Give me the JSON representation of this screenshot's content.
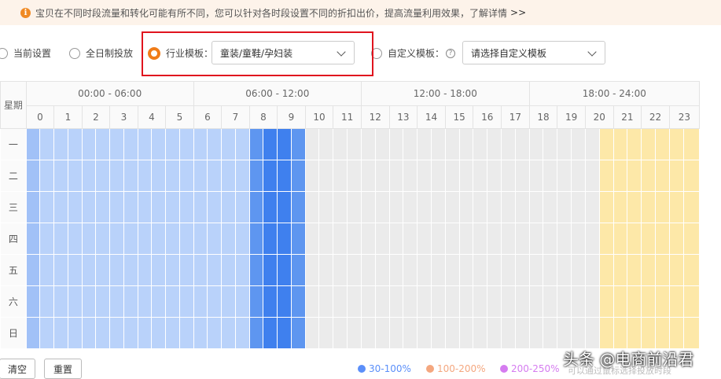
{
  "notice": {
    "icon": "info-icon",
    "text": "宝贝在不同时段流量和转化可能有所不同，您可以针对各时段设置不同的折扣出价，提高流量利用效果，了解详情",
    "more": ">>"
  },
  "options": {
    "current_label": "当前设置",
    "allday_label": "全日制投放",
    "industry_label": "行业模板：",
    "industry_select": "童装/童鞋/孕妇装",
    "custom_label": "自定义模板：",
    "custom_select": "请选择自定义模板",
    "selected": "industry"
  },
  "schedule": {
    "day_header": "星期",
    "ranges": [
      "00:00 - 06:00",
      "06:00 - 12:00",
      "12:00 - 18:00",
      "18:00 - 24:00"
    ],
    "hours": [
      "0",
      "1",
      "2",
      "3",
      "4",
      "5",
      "6",
      "7",
      "8",
      "9",
      "10",
      "11",
      "12",
      "13",
      "14",
      "15",
      "16",
      "17",
      "18",
      "19",
      "20",
      "21",
      "22",
      "23"
    ],
    "days": [
      "一",
      "二",
      "三",
      "四",
      "五",
      "六",
      "日"
    ],
    "palette": {
      "0": "#ebebeb",
      "1": "#b9d2fa",
      "2": "#a1c1f7",
      "3": "#5e96f0",
      "4": "#3f80ee",
      "5": "#2a72ea",
      "6": "#fde8a8"
    },
    "levels": [
      [
        2,
        1,
        1,
        1,
        1,
        1,
        1,
        1,
        1,
        1,
        1,
        1,
        1,
        1,
        1,
        1,
        3,
        4,
        4,
        3,
        0,
        0,
        0,
        0,
        0,
        0,
        0,
        0,
        0,
        0,
        0,
        0,
        0,
        0,
        0,
        0,
        0,
        0,
        0,
        0,
        0,
        6,
        6,
        6,
        6,
        6,
        6,
        6,
        6,
        6,
        6,
        6,
        6,
        6,
        6,
        3,
        3,
        3,
        3,
        3,
        3,
        4,
        4,
        4,
        4,
        5,
        5,
        5,
        5,
        5,
        5,
        4,
        4,
        3,
        3
      ],
      [
        2,
        1,
        1,
        1,
        1,
        1,
        1,
        1,
        1,
        1,
        1,
        1,
        1,
        1,
        1,
        1,
        3,
        4,
        4,
        3,
        0,
        0,
        0,
        0,
        0,
        0,
        0,
        0,
        0,
        0,
        0,
        0,
        0,
        0,
        0,
        0,
        0,
        0,
        0,
        0,
        0,
        6,
        6,
        6,
        6,
        6,
        6,
        6,
        6,
        6,
        6,
        6,
        6,
        6,
        6,
        3,
        3,
        3,
        3,
        3,
        3,
        4,
        4,
        4,
        4,
        5,
        5,
        5,
        5,
        5,
        5,
        4,
        4,
        3,
        3
      ],
      [
        2,
        1,
        1,
        1,
        1,
        1,
        1,
        1,
        1,
        1,
        1,
        1,
        1,
        1,
        1,
        1,
        3,
        4,
        4,
        3,
        0,
        0,
        0,
        0,
        0,
        0,
        0,
        0,
        0,
        0,
        0,
        0,
        0,
        0,
        0,
        0,
        0,
        0,
        0,
        0,
        0,
        6,
        6,
        6,
        6,
        6,
        6,
        6,
        6,
        6,
        6,
        6,
        6,
        6,
        6,
        3,
        3,
        3,
        3,
        3,
        3,
        4,
        4,
        4,
        4,
        5,
        5,
        5,
        5,
        5,
        5,
        4,
        4,
        3,
        3
      ],
      [
        2,
        1,
        1,
        1,
        1,
        1,
        1,
        1,
        1,
        1,
        1,
        1,
        1,
        1,
        1,
        1,
        3,
        4,
        4,
        3,
        0,
        0,
        0,
        0,
        0,
        0,
        0,
        0,
        0,
        0,
        0,
        0,
        0,
        0,
        0,
        0,
        0,
        0,
        0,
        0,
        0,
        6,
        6,
        6,
        6,
        6,
        6,
        6,
        6,
        6,
        6,
        6,
        6,
        6,
        6,
        3,
        3,
        3,
        3,
        3,
        3,
        4,
        4,
        4,
        4,
        5,
        5,
        5,
        5,
        5,
        5,
        4,
        4,
        3,
        3
      ],
      [
        2,
        1,
        1,
        1,
        1,
        1,
        1,
        1,
        1,
        1,
        1,
        1,
        1,
        1,
        1,
        1,
        3,
        4,
        4,
        3,
        0,
        0,
        0,
        0,
        0,
        0,
        0,
        0,
        0,
        0,
        0,
        0,
        0,
        0,
        0,
        0,
        0,
        0,
        0,
        0,
        0,
        6,
        6,
        6,
        6,
        6,
        6,
        6,
        6,
        6,
        6,
        6,
        6,
        6,
        6,
        3,
        3,
        3,
        3,
        3,
        3,
        4,
        4,
        4,
        4,
        5,
        5,
        5,
        5,
        5,
        5,
        4,
        4,
        3,
        3
      ],
      [
        2,
        1,
        1,
        1,
        1,
        1,
        1,
        1,
        1,
        1,
        1,
        1,
        1,
        1,
        1,
        1,
        3,
        4,
        4,
        3,
        0,
        0,
        0,
        0,
        0,
        0,
        0,
        0,
        0,
        0,
        0,
        0,
        0,
        0,
        0,
        0,
        0,
        0,
        0,
        0,
        0,
        6,
        6,
        6,
        6,
        6,
        6,
        6,
        6,
        6,
        6,
        6,
        6,
        6,
        6,
        3,
        3,
        3,
        3,
        3,
        3,
        4,
        4,
        4,
        4,
        0,
        0,
        0,
        0,
        0,
        0,
        0,
        0,
        3,
        3
      ],
      [
        2,
        1,
        1,
        1,
        1,
        1,
        1,
        1,
        1,
        1,
        1,
        1,
        1,
        1,
        1,
        1,
        3,
        4,
        4,
        3,
        0,
        0,
        0,
        0,
        0,
        0,
        0,
        0,
        0,
        0,
        0,
        0,
        0,
        0,
        0,
        0,
        0,
        0,
        0,
        0,
        0,
        6,
        6,
        6,
        6,
        6,
        6,
        6,
        6,
        6,
        6,
        6,
        6,
        6,
        6,
        3,
        3,
        3,
        3,
        3,
        3,
        4,
        4,
        4,
        4,
        0,
        0,
        0,
        0,
        0,
        0,
        0,
        0,
        3,
        3
      ]
    ]
  },
  "footer": {
    "clear_label": "清空",
    "reset_label": "重置",
    "legend": [
      {
        "label": "30-100%",
        "color": "#5b8ff9"
      },
      {
        "label": "100-200%",
        "color": "#f4a77f"
      },
      {
        "label": "200-250%",
        "color": "#d57cf0"
      }
    ],
    "hint": "可以通过鼠标选择投放时段"
  },
  "watermark": "头条 @电商前沿君"
}
